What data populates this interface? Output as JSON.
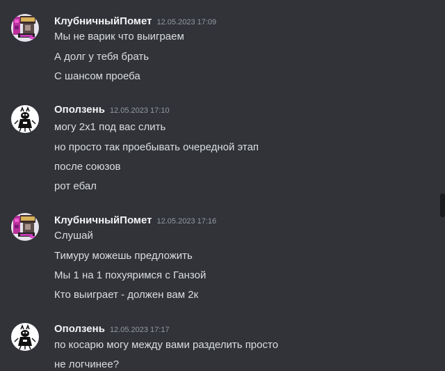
{
  "groups": [
    {
      "author": "КлубничныйПомет",
      "timestamp": "12.05.2023 17:09",
      "avatar_icon": "pixel-art-avatar",
      "messages": [
        "Мы не варик что выиграем",
        "А долг у тебя брать",
        "С шансом проеба"
      ]
    },
    {
      "author": "Оползень",
      "timestamp": "12.05.2023 17:10",
      "avatar_icon": "ink-sketch-avatar",
      "messages": [
        "могу 2х1 под вас слить",
        "но просто так проебывать очередной этап",
        "после союзов",
        "рот ебал"
      ]
    },
    {
      "author": "КлубничныйПомет",
      "timestamp": "12.05.2023 17:16",
      "avatar_icon": "pixel-art-avatar",
      "messages": [
        "Слушай",
        "Тимуру можешь предложить",
        "Мы 1 на 1 похуяримся с Ганзой",
        "Кто выиграет - должен вам 2к"
      ]
    },
    {
      "author": "Оползень",
      "timestamp": "12.05.2023 17:17",
      "avatar_icon": "ink-sketch-avatar",
      "messages": [
        "по косарю могу между вами разделить просто",
        "не логчинее?"
      ]
    }
  ],
  "colors": {
    "background": "#313338",
    "author": "#f2f3f5",
    "message": "#dbdee1",
    "timestamp": "#949ba4"
  }
}
